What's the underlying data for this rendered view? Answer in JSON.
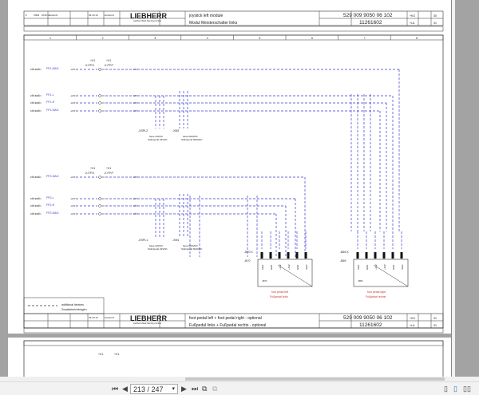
{
  "page_top": {
    "title_en": "joystick left module",
    "title_de": "Modul Meisterschalter links",
    "drawing_no": "529 009 9050 06 102",
    "doc_no": "11261602",
    "plant": "+KG",
    "location": "+LA",
    "sheet": "30",
    "sheet_next": "31",
    "logo": "LIEBHERR",
    "company": "Liebherr-Werk Nenzing GmbH",
    "date": "03.10.13",
    "author": "konkurz1",
    "rev": [
      "8",
      "15843",
      "25.08.14",
      "konkurz1"
    ]
  },
  "page_mid": {
    "title_en": "foot pedal left + foot pedal right - optional",
    "title_de": "Fußpedal links + Fußpedal rechts - optional",
    "drawing_no": "529 009 9050 06 102",
    "doc_no": "11261602",
    "plant": "+KG",
    "location": "+LA",
    "sheet": "31",
    "sheet_next": "31",
    "logo": "LIEBHERR",
    "company": "Liebherr-Werk Nenzing GmbH",
    "date": "03.10.13",
    "author": "konkurz1",
    "columns": [
      "1",
      "2",
      "3",
      "4",
      "5",
      "6",
      "7",
      "8"
    ],
    "legend": {
      "line1": "additional devices",
      "line2": "Zusatzeinrichtungen"
    },
    "groups": [
      {
        "rows": [
          {
            "src": "ctrl.sw6=",
            "sig": "FP1-MAG",
            "wire": "-A70"
          },
          {
            "src": "ctrl.sw6=",
            "sig": "FP1-L",
            "wire": "-A70"
          },
          {
            "src": "ctrl.sw6=",
            "sig": "FP1-R",
            "wire": "-A70"
          },
          {
            "src": "ctrl.sw6=",
            "sig": "FP1-MAG",
            "wire": "-A70"
          }
        ],
        "conn1": "-X.FP.S",
        "conn2": "-X.FP.P",
        "plus": "+X1",
        "xspl": "-XSPL2",
        "xm": "-XM2"
      },
      {
        "rows": [
          {
            "src": "ctrl.sw6=",
            "sig": "FP2-MAG",
            "wire": "-A70"
          },
          {
            "src": "ctrl.sw6=",
            "sig": "FP2-L",
            "wire": "-A70"
          },
          {
            "src": "ctrl.sw6=",
            "sig": "FP2-R",
            "wire": "-A70"
          },
          {
            "src": "ctrl.sw6=",
            "sig": "FP2-MAG",
            "wire": "-A70"
          }
        ],
        "conn1": "-X.FP.S",
        "conn2": "-X.FP.P",
        "plus": "+X1",
        "xspl": "-XSPL1",
        "xm": "-XM1"
      }
    ],
    "base24_en": "base 24VDC",
    "base24_de": "Stützpunkt 24VDC",
    "base60_en": "base 60AVDC",
    "base60_de": "Stützpunkt 60AVDC",
    "pedal_left": {
      "plug": "-B70.X",
      "dev": "-B70",
      "name_en": "foot pedal left",
      "name_de": "Fußpedal links"
    },
    "pedal_right": {
      "plug": "-B69.X",
      "dev": "-B69",
      "name_en": "foot pedal right",
      "name_de": "Fußpedal rechts"
    },
    "pins": [
      "SIG1",
      "GND",
      "+24V",
      "+24V",
      "GND",
      "SIG2"
    ]
  },
  "page_bottom": {
    "plus": "+X1"
  },
  "toolbar": {
    "page": "213 / 247"
  },
  "colors": {
    "wire": "#3a3ad0",
    "red": "#c0392b"
  }
}
